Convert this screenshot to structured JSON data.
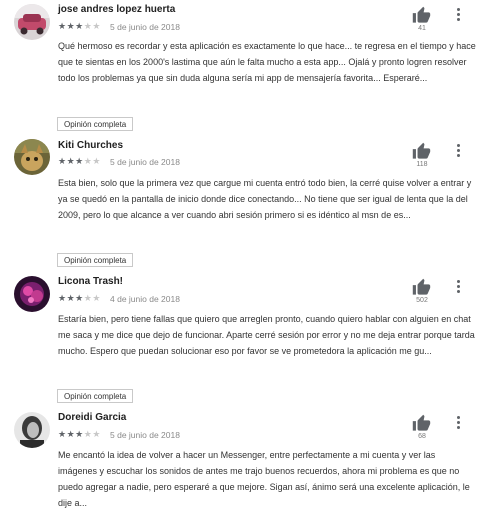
{
  "reviews": [
    {
      "name": "jose andres lopez huerta",
      "rating": 3,
      "date": "5 de junio de 2018",
      "likes": "41",
      "text": "Qué hermoso es recordar y esta aplicación es exactamente lo que hace... te regresa en el tiempo y hace que te sientas en los 2000's lastima que aún le falta mucho a esta app... Ojalá y pronto logren resolver todo los problemas ya que sin duda alguna sería mi app de mensajería favorita... Esperaré...",
      "full_review_label": "Opinión completa"
    },
    {
      "name": "Kiti Churches",
      "rating": 3,
      "date": "5 de junio de 2018",
      "likes": "118",
      "text": "Esta bien, solo que la primera vez que cargue mi cuenta entró todo bien, la cerré quise volver a entrar y ya se quedó en la pantalla de inicio donde dice conectando... No tiene que ser igual de lenta que la del 2009, pero lo que alcance a ver cuando abri sesión primero si es idéntico al msn de es...",
      "full_review_label": "Opinión completa"
    },
    {
      "name": "Licona Trash!",
      "rating": 3,
      "date": "4 de junio de 2018",
      "likes": "502",
      "text": "Estaría bien, pero tiene fallas que quiero que arreglen pronto, cuando quiero hablar con alguien en chat me saca y me dice que dejo de funcionar. Aparte cerré sesión por error y no me deja entrar porque tarda mucho. Espero que puedan solucionar eso por favor se ve prometedora la aplicación me gu...",
      "full_review_label": "Opinión completa"
    },
    {
      "name": "Doreidi Garcia",
      "rating": 3,
      "date": "5 de junio de 2018",
      "likes": "68",
      "text": "Me encantó la idea de volver a hacer un Messenger, entre perfectamente a mi cuenta y ver las imágenes y escuchar los sonidos de antes me trajo buenos recuerdos, ahora mi problema es que no puedo agregar a nadie, pero esperaré a que mejore. Sigan así, ánimo será una excelente aplicación, le dije a...",
      "full_review_label": ""
    }
  ],
  "icons": {
    "like": "thumbs-up-icon",
    "more": "more-vert-icon",
    "star": "star-icon"
  },
  "colors": {
    "star_filled": "#5f6368",
    "star_empty": "#c8c8c8",
    "icon": "#5f6368"
  }
}
